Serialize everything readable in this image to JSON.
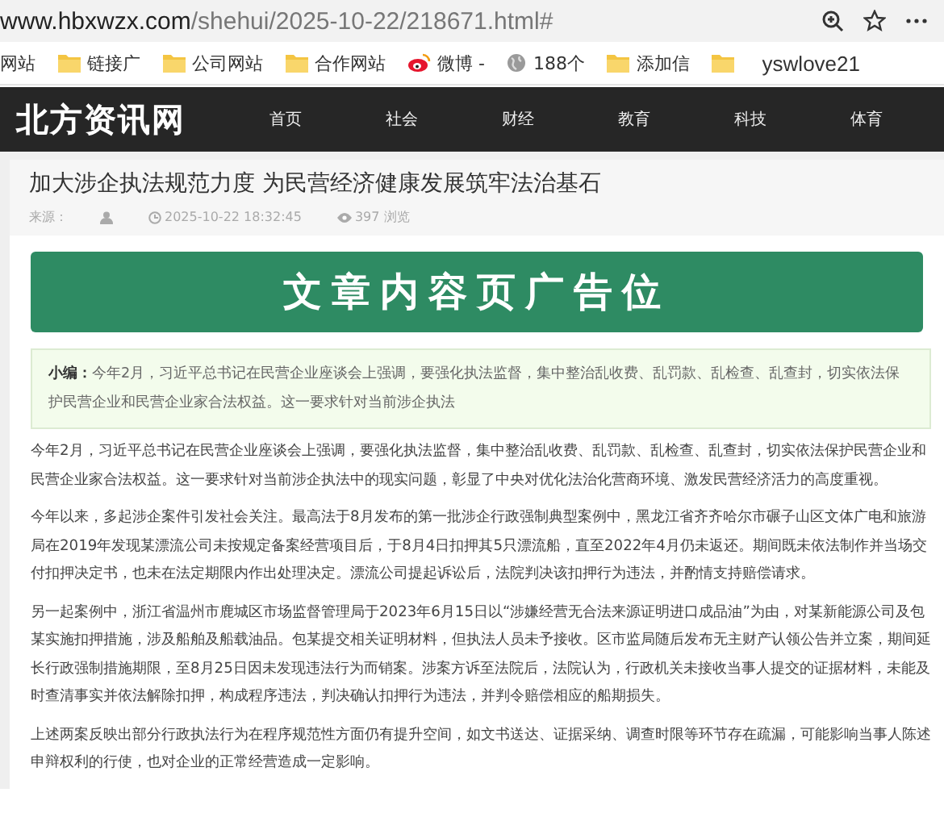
{
  "address_bar": {
    "host": "www.hbxwzx.com",
    "path": "/shehui/2025-10-22/218671.html#"
  },
  "bookmarks": {
    "items": [
      {
        "kind": "plain",
        "label": "网站"
      },
      {
        "kind": "folder",
        "label": "链接广"
      },
      {
        "kind": "folder",
        "label": "公司网站"
      },
      {
        "kind": "folder",
        "label": "合作网站"
      },
      {
        "kind": "weibo",
        "label": "微博 -"
      },
      {
        "kind": "globe",
        "label": "188个"
      },
      {
        "kind": "folder",
        "label": "添加信"
      },
      {
        "kind": "folder"
      }
    ],
    "user": "yswlove21"
  },
  "site_nav": {
    "logo": "北方资讯网",
    "items": [
      "首页",
      "社会",
      "财经",
      "教育",
      "科技",
      "体育"
    ]
  },
  "article": {
    "title": "加大涉企执法规范力度 为民营经济健康发展筑牢法治基石",
    "source_label": "来源：",
    "datetime": "2025-10-22 18:32:45",
    "views": "397 浏览",
    "ad_banner": "文章内容页广告位",
    "summary": "**小编：**今年2月，习近平总书记在民营企业座谈会上强调，要强化执法监督，集中整治乱收费、乱罚款、乱检查、乱查封，切实依法保护民营企业和民营企业家合法权益。这一要求针对当前涉企执法",
    "paragraphs": [
      "今年2月，习近平总书记在民营企业座谈会上强调，要强化执法监督，集中整治乱收费、乱罚款、乱检查、乱查封，切实依法保护民营企业和民营企业家合法权益。这一要求针对当前涉企执法中的现实问题，彰显了中央对优化法治化营商环境、激发民营经济活力的高度重视。",
      "今年以来，多起涉企案件引发社会关注。最高法于8月发布的第一批涉企行政强制典型案例中，黑龙江省齐齐哈尔市碾子山区文体广电和旅游局在2019年发现某漂流公司未按规定备案经营项目后，于8月4日扣押其5只漂流船，直至2022年4月仍未返还。期间既未依法制作并当场交付扣押决定书，也未在法定期限内作出处理决定。漂流公司提起诉讼后，法院判决该扣押行为违法，并酌情支持赔偿请求。",
      "另一起案例中，浙江省温州市鹿城区市场监督管理局于2023年6月15日以“涉嫌经营无合法来源证明进口成品油”为由，对某新能源公司及包某实施扣押措施，涉及船舶及船载油品。包某提交相关证明材料，但执法人员未予接收。区市监局随后发布无主财产认领公告并立案，期间延长行政强制措施期限，至8月25日因未发现违法行为而销案。涉案方诉至法院后，法院认为，行政机关未接收当事人提交的证据材料，未能及时查清事实并依法解除扣押，构成程序违法，判决确认扣押行为违法，并判令赔偿相应的船期损失。",
      "上述两案反映出部分行政执法行为在程序规范性方面仍有提升空间，如文书送达、证据采纳、调查时限等环节存在疏漏，可能影响当事人陈述申辩权利的行使，也对企业的正常经营造成一定影响。"
    ]
  }
}
